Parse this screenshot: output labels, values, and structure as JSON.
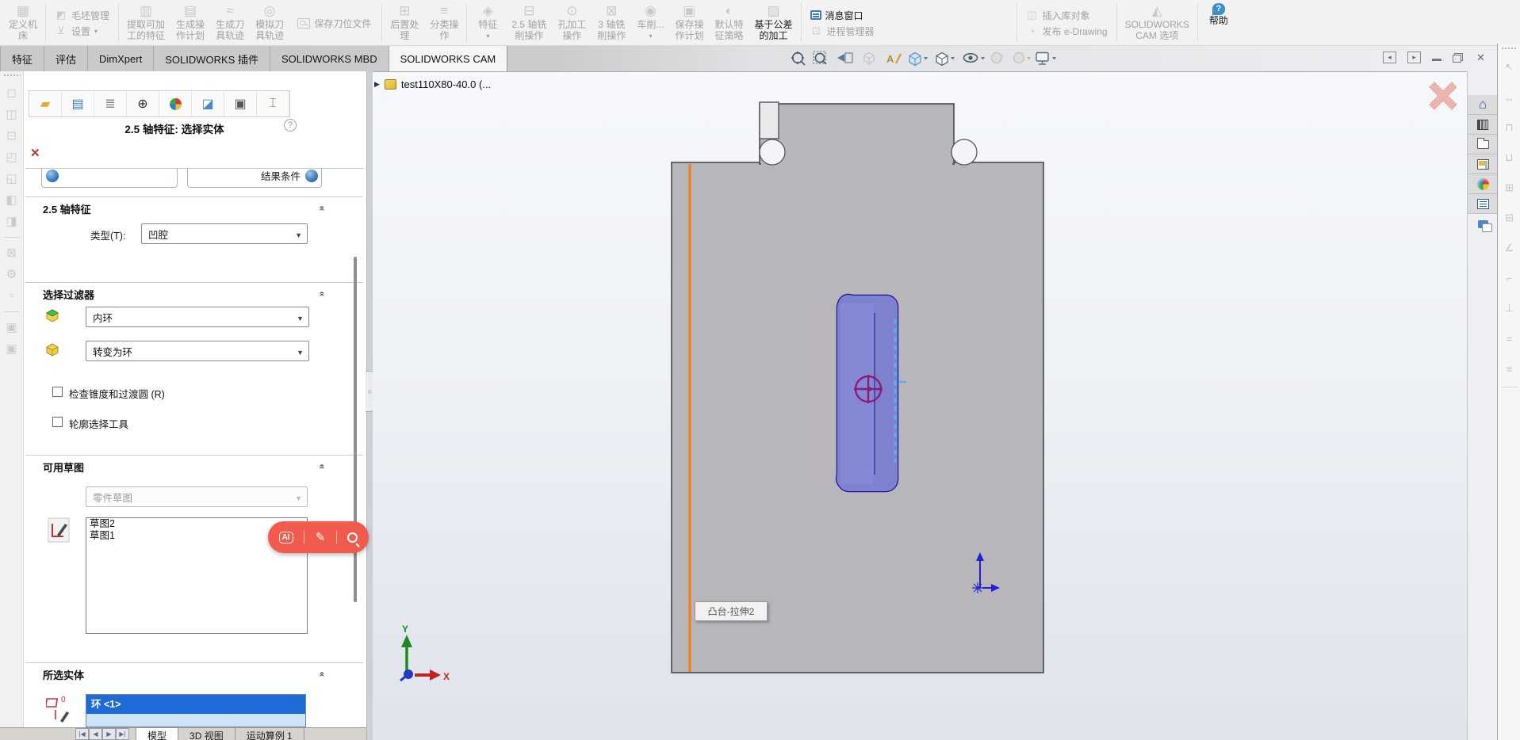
{
  "window": {
    "tabs": [
      "特征",
      "评估",
      "DimXpert",
      "SOLIDWORKS 插件",
      "SOLIDWORKS MBD",
      "SOLIDWORKS CAM"
    ],
    "active_tab": "SOLIDWORKS CAM",
    "window_controls": [
      "previous-pane",
      "next-pane",
      "minimize",
      "restore",
      "close"
    ]
  },
  "ribbon": {
    "buttons": [
      {
        "kind": "large",
        "name": "define-machine-button",
        "icon": "machine-icon",
        "glyph": "▦",
        "lines": [
          "定义机",
          "床"
        ],
        "enabled": false
      },
      {
        "kind": "sep"
      },
      {
        "kind": "stack",
        "name": "stock-group",
        "rows": [
          {
            "name": "stock-manager-button",
            "icon": "stock-manage-icon",
            "glyph": "◩",
            "label": "毛坯管理",
            "enabled": false,
            "arrow": false
          },
          {
            "name": "setup-button",
            "icon": "setup-icon",
            "glyph": "⊻",
            "label": "设置",
            "enabled": false,
            "arrow": true
          }
        ]
      },
      {
        "kind": "sep"
      },
      {
        "kind": "large",
        "name": "extract-machinable-features-button",
        "icon": "extract-features-icon",
        "glyph": "▥",
        "lines": [
          "提取可加",
          "工的特征"
        ],
        "enabled": false
      },
      {
        "kind": "large",
        "name": "generate-operation-plan-button",
        "icon": "operation-plan-icon",
        "glyph": "▤",
        "lines": [
          "生成操",
          "作计划"
        ],
        "enabled": false
      },
      {
        "kind": "large",
        "name": "generate-toolpath-button",
        "icon": "toolpath-icon",
        "glyph": "≈",
        "lines": [
          "生成刀",
          "具轨迹"
        ],
        "enabled": false
      },
      {
        "kind": "large",
        "name": "simulate-toolpath-button",
        "icon": "simulate-toolpath-icon",
        "glyph": "◎",
        "lines": [
          "模拟刀",
          "具轨迹"
        ],
        "enabled": false
      },
      {
        "kind": "wide",
        "name": "save-cl-file-button",
        "icon": "cl-file-icon",
        "glyph": "CL",
        "lines": [
          "保存刀位文件"
        ],
        "enabled": false
      },
      {
        "kind": "sep"
      },
      {
        "kind": "large",
        "name": "post-process-button",
        "icon": "post-process-icon",
        "glyph": "⊞",
        "lines": [
          "后置处",
          "理"
        ],
        "enabled": false
      },
      {
        "kind": "large",
        "name": "sort-operations-button",
        "icon": "sort-operations-icon",
        "glyph": "≡",
        "lines": [
          "分类操",
          "作"
        ],
        "enabled": false
      },
      {
        "kind": "sep"
      },
      {
        "kind": "large",
        "name": "feature-button",
        "icon": "feature-icon",
        "glyph": "◈",
        "lines": [
          "特征"
        ],
        "enabled": false,
        "arrow": true
      },
      {
        "kind": "large",
        "name": "mill-25axis-operation-button",
        "icon": "mill-25axis-icon",
        "glyph": "⊟",
        "lines": [
          "2.5 轴铣",
          "削操作"
        ],
        "enabled": false
      },
      {
        "kind": "large",
        "name": "hole-operation-button",
        "icon": "hole-machining-icon",
        "glyph": "⊙",
        "lines": [
          "孔加工",
          "操作"
        ],
        "enabled": false
      },
      {
        "kind": "large",
        "name": "mill-3axis-operation-button",
        "icon": "mill-3axis-icon",
        "glyph": "⊠",
        "lines": [
          "3 轴铣",
          "削操作"
        ],
        "enabled": false
      },
      {
        "kind": "large",
        "name": "turning-button",
        "icon": "turning-icon",
        "glyph": "◉",
        "lines": [
          "车削..."
        ],
        "enabled": false,
        "arrow": true
      },
      {
        "kind": "large",
        "name": "save-operation-plan-button",
        "icon": "save-plan-icon",
        "glyph": "▣",
        "lines": [
          "保存操",
          "作计划"
        ],
        "enabled": false
      },
      {
        "kind": "large",
        "name": "default-feature-strategy-button",
        "icon": "strategy-icon",
        "glyph": "◐",
        "lines": [
          "默认特",
          "征策略"
        ],
        "enabled": false
      },
      {
        "kind": "large",
        "name": "tolerance-based-machining-button",
        "icon": "tolerance-machining-icon",
        "glyph": "▨",
        "lines": [
          "基于公差",
          "的加工"
        ],
        "enabled": true,
        "colored": true
      },
      {
        "kind": "sep"
      },
      {
        "kind": "stack",
        "name": "message-group",
        "rows": [
          {
            "name": "message-window-button",
            "icon": "message-window-icon",
            "glyph": "▤",
            "label": "消息窗口",
            "enabled": true,
            "special": "msg"
          },
          {
            "name": "process-manager-button",
            "icon": "process-manager-icon",
            "glyph": "⊡",
            "label": "进程管理器",
            "enabled": false
          }
        ]
      },
      {
        "kind": "gap"
      },
      {
        "kind": "sep"
      },
      {
        "kind": "stack",
        "name": "library-group",
        "rows": [
          {
            "name": "insert-library-object-button",
            "icon": "library-object-icon",
            "glyph": "◫",
            "label": "插入库对象",
            "enabled": false
          },
          {
            "name": "publish-edrawing-button",
            "icon": "edrawing-icon",
            "glyph": "◔",
            "label": "发布 e-Drawing",
            "enabled": false
          }
        ]
      },
      {
        "kind": "sep"
      },
      {
        "kind": "large",
        "name": "solidworks-cam-options-button",
        "icon": "cam-options-icon",
        "glyph": "◭",
        "lines": [
          "SOLIDWORKS",
          "CAM 选项"
        ],
        "enabled": false
      },
      {
        "kind": "sep"
      },
      {
        "kind": "large",
        "name": "help-button",
        "icon": "help-icon",
        "glyph": "?",
        "lines": [
          "帮助"
        ],
        "enabled": true
      }
    ]
  },
  "heads_up": {
    "icons": [
      "zoom-fit-icon",
      "zoom-area-icon",
      "previous-view-icon",
      "section-view-icon",
      "annotation-icon",
      "view-orientation-icon",
      "display-style-icon",
      "hide-show-items-icon",
      "edit-appearance-icon",
      "apply-scene-icon",
      "view-settings-icon"
    ]
  },
  "left_strip": {
    "icons": [
      "◻",
      "◫",
      "⊡",
      "◰",
      "◱",
      "◧",
      "◨",
      "|",
      "⊠",
      "⚙",
      "▫",
      "|",
      "▣",
      "▣"
    ]
  },
  "panel": {
    "pm_tabs": [
      "feature-manager-tab",
      "property-manager-tab",
      "configuration-manager-tab",
      "dimxpert-manager-tab",
      "display-manager-tab",
      "cam-feature-tree-tab",
      "cam-operation-tree-tab",
      "cam-tools-tab"
    ],
    "title": "2.5 轴特征:  选择实体",
    "clipped_right_label": "结果条件",
    "section1": "2.5 轴特征",
    "type_label": "类型(T):",
    "type_value": "凹腔",
    "section2": "选择过滤器",
    "filter1_value": "内环",
    "filter2_value": "转变为环",
    "check1_label": "检查锥度和过渡圆  (R)",
    "check2_label": "轮廓选择工具",
    "section3": "可用草图",
    "sketch_source_value": "零件草图",
    "sketch_items": [
      "草图2",
      "草图1"
    ],
    "section4": "所选实体",
    "selected_item": "环 <1>"
  },
  "bottom": {
    "tabs": [
      "模型",
      "3D 视图",
      "运动算例 1"
    ],
    "active": "模型",
    "vcr": [
      "|◀",
      "◀",
      "▶",
      "▶|"
    ]
  },
  "viewport": {
    "tree_label": "test110X80-40.0  (...",
    "tooltip": "凸台-拉伸2",
    "axis_x": "X",
    "axis_y": "Y"
  },
  "overlay": {
    "ai_label": "AI",
    "icons": [
      "ai-chat-icon",
      "magic-edit-icon",
      "search-icon"
    ]
  },
  "taskpane": {
    "side_icons": [
      "home-icon",
      "design-library-icon",
      "file-explorer-icon",
      "view-palette-icon",
      "appearances-icon",
      "custom-properties-icon",
      "forum-icon"
    ],
    "edge_icons": [
      "↖",
      "↔",
      "⊓",
      "⊔",
      "⊞",
      "⊟",
      "∠",
      "⌐",
      "⊥",
      "=",
      "≡"
    ]
  },
  "colors": {
    "selection_blue": "#1e6bd8",
    "highlight_orange": "#ec8420",
    "slot_fill": "#7d81ce",
    "slot_outline": "#16169b",
    "dashed_edge_blue": "#5ab0f0",
    "crosshair_purple": "#8b1e74",
    "overlay_red": "#f15b4e",
    "part_gray": "#b8b5bb"
  }
}
